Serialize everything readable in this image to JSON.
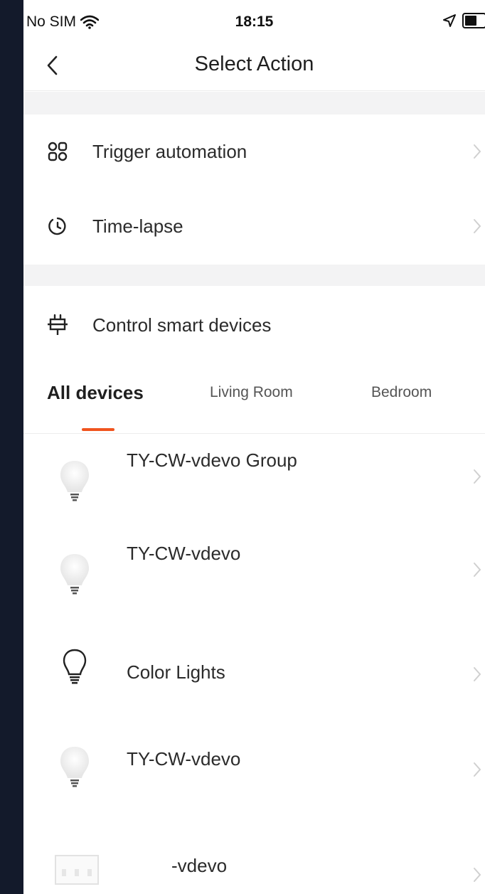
{
  "status_bar": {
    "carrier": "No SIM",
    "time": "18:15"
  },
  "nav": {
    "title": "Select Action"
  },
  "actions": [
    {
      "label": "Trigger automation",
      "icon": "automation-icon"
    },
    {
      "label": "Time-lapse",
      "icon": "timer-icon"
    }
  ],
  "control": {
    "label": "Control smart devices",
    "icon": "plug-icon"
  },
  "tabs": [
    {
      "label": "All devices",
      "active": true
    },
    {
      "label": "Living Room",
      "active": false
    },
    {
      "label": "Bedroom",
      "active": false
    }
  ],
  "devices": [
    {
      "label": "TY-CW-vdevo Group",
      "icon": "bulb-faded-icon"
    },
    {
      "label": "TY-CW-vdevo",
      "icon": "bulb-faded-icon"
    },
    {
      "label": "Color Lights",
      "icon": "bulb-outline-icon"
    },
    {
      "label": "TY-CW-vdevo",
      "icon": "bulb-faded-icon"
    },
    {
      "label": "-vdevo",
      "icon": "switch-panel-icon"
    }
  ],
  "colors": {
    "accent": "#f0541e",
    "background": "#131a2b",
    "band": "#f3f3f4"
  }
}
